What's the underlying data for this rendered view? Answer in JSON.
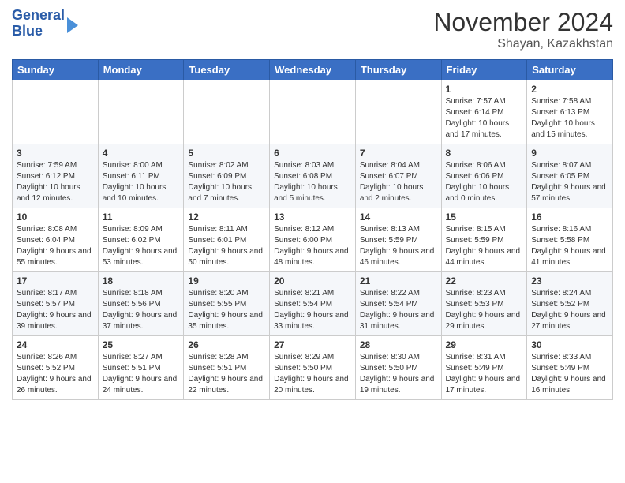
{
  "header": {
    "logo_line1": "General",
    "logo_line2": "Blue",
    "title": "November 2024",
    "subtitle": "Shayan, Kazakhstan"
  },
  "days_of_week": [
    "Sunday",
    "Monday",
    "Tuesday",
    "Wednesday",
    "Thursday",
    "Friday",
    "Saturday"
  ],
  "weeks": [
    [
      {
        "day": "",
        "content": ""
      },
      {
        "day": "",
        "content": ""
      },
      {
        "day": "",
        "content": ""
      },
      {
        "day": "",
        "content": ""
      },
      {
        "day": "",
        "content": ""
      },
      {
        "day": "1",
        "content": "Sunrise: 7:57 AM\nSunset: 6:14 PM\nDaylight: 10 hours and 17 minutes."
      },
      {
        "day": "2",
        "content": "Sunrise: 7:58 AM\nSunset: 6:13 PM\nDaylight: 10 hours and 15 minutes."
      }
    ],
    [
      {
        "day": "3",
        "content": "Sunrise: 7:59 AM\nSunset: 6:12 PM\nDaylight: 10 hours and 12 minutes."
      },
      {
        "day": "4",
        "content": "Sunrise: 8:00 AM\nSunset: 6:11 PM\nDaylight: 10 hours and 10 minutes."
      },
      {
        "day": "5",
        "content": "Sunrise: 8:02 AM\nSunset: 6:09 PM\nDaylight: 10 hours and 7 minutes."
      },
      {
        "day": "6",
        "content": "Sunrise: 8:03 AM\nSunset: 6:08 PM\nDaylight: 10 hours and 5 minutes."
      },
      {
        "day": "7",
        "content": "Sunrise: 8:04 AM\nSunset: 6:07 PM\nDaylight: 10 hours and 2 minutes."
      },
      {
        "day": "8",
        "content": "Sunrise: 8:06 AM\nSunset: 6:06 PM\nDaylight: 10 hours and 0 minutes."
      },
      {
        "day": "9",
        "content": "Sunrise: 8:07 AM\nSunset: 6:05 PM\nDaylight: 9 hours and 57 minutes."
      }
    ],
    [
      {
        "day": "10",
        "content": "Sunrise: 8:08 AM\nSunset: 6:04 PM\nDaylight: 9 hours and 55 minutes."
      },
      {
        "day": "11",
        "content": "Sunrise: 8:09 AM\nSunset: 6:02 PM\nDaylight: 9 hours and 53 minutes."
      },
      {
        "day": "12",
        "content": "Sunrise: 8:11 AM\nSunset: 6:01 PM\nDaylight: 9 hours and 50 minutes."
      },
      {
        "day": "13",
        "content": "Sunrise: 8:12 AM\nSunset: 6:00 PM\nDaylight: 9 hours and 48 minutes."
      },
      {
        "day": "14",
        "content": "Sunrise: 8:13 AM\nSunset: 5:59 PM\nDaylight: 9 hours and 46 minutes."
      },
      {
        "day": "15",
        "content": "Sunrise: 8:15 AM\nSunset: 5:59 PM\nDaylight: 9 hours and 44 minutes."
      },
      {
        "day": "16",
        "content": "Sunrise: 8:16 AM\nSunset: 5:58 PM\nDaylight: 9 hours and 41 minutes."
      }
    ],
    [
      {
        "day": "17",
        "content": "Sunrise: 8:17 AM\nSunset: 5:57 PM\nDaylight: 9 hours and 39 minutes."
      },
      {
        "day": "18",
        "content": "Sunrise: 8:18 AM\nSunset: 5:56 PM\nDaylight: 9 hours and 37 minutes."
      },
      {
        "day": "19",
        "content": "Sunrise: 8:20 AM\nSunset: 5:55 PM\nDaylight: 9 hours and 35 minutes."
      },
      {
        "day": "20",
        "content": "Sunrise: 8:21 AM\nSunset: 5:54 PM\nDaylight: 9 hours and 33 minutes."
      },
      {
        "day": "21",
        "content": "Sunrise: 8:22 AM\nSunset: 5:54 PM\nDaylight: 9 hours and 31 minutes."
      },
      {
        "day": "22",
        "content": "Sunrise: 8:23 AM\nSunset: 5:53 PM\nDaylight: 9 hours and 29 minutes."
      },
      {
        "day": "23",
        "content": "Sunrise: 8:24 AM\nSunset: 5:52 PM\nDaylight: 9 hours and 27 minutes."
      }
    ],
    [
      {
        "day": "24",
        "content": "Sunrise: 8:26 AM\nSunset: 5:52 PM\nDaylight: 9 hours and 26 minutes."
      },
      {
        "day": "25",
        "content": "Sunrise: 8:27 AM\nSunset: 5:51 PM\nDaylight: 9 hours and 24 minutes."
      },
      {
        "day": "26",
        "content": "Sunrise: 8:28 AM\nSunset: 5:51 PM\nDaylight: 9 hours and 22 minutes."
      },
      {
        "day": "27",
        "content": "Sunrise: 8:29 AM\nSunset: 5:50 PM\nDaylight: 9 hours and 20 minutes."
      },
      {
        "day": "28",
        "content": "Sunrise: 8:30 AM\nSunset: 5:50 PM\nDaylight: 9 hours and 19 minutes."
      },
      {
        "day": "29",
        "content": "Sunrise: 8:31 AM\nSunset: 5:49 PM\nDaylight: 9 hours and 17 minutes."
      },
      {
        "day": "30",
        "content": "Sunrise: 8:33 AM\nSunset: 5:49 PM\nDaylight: 9 hours and 16 minutes."
      }
    ]
  ]
}
